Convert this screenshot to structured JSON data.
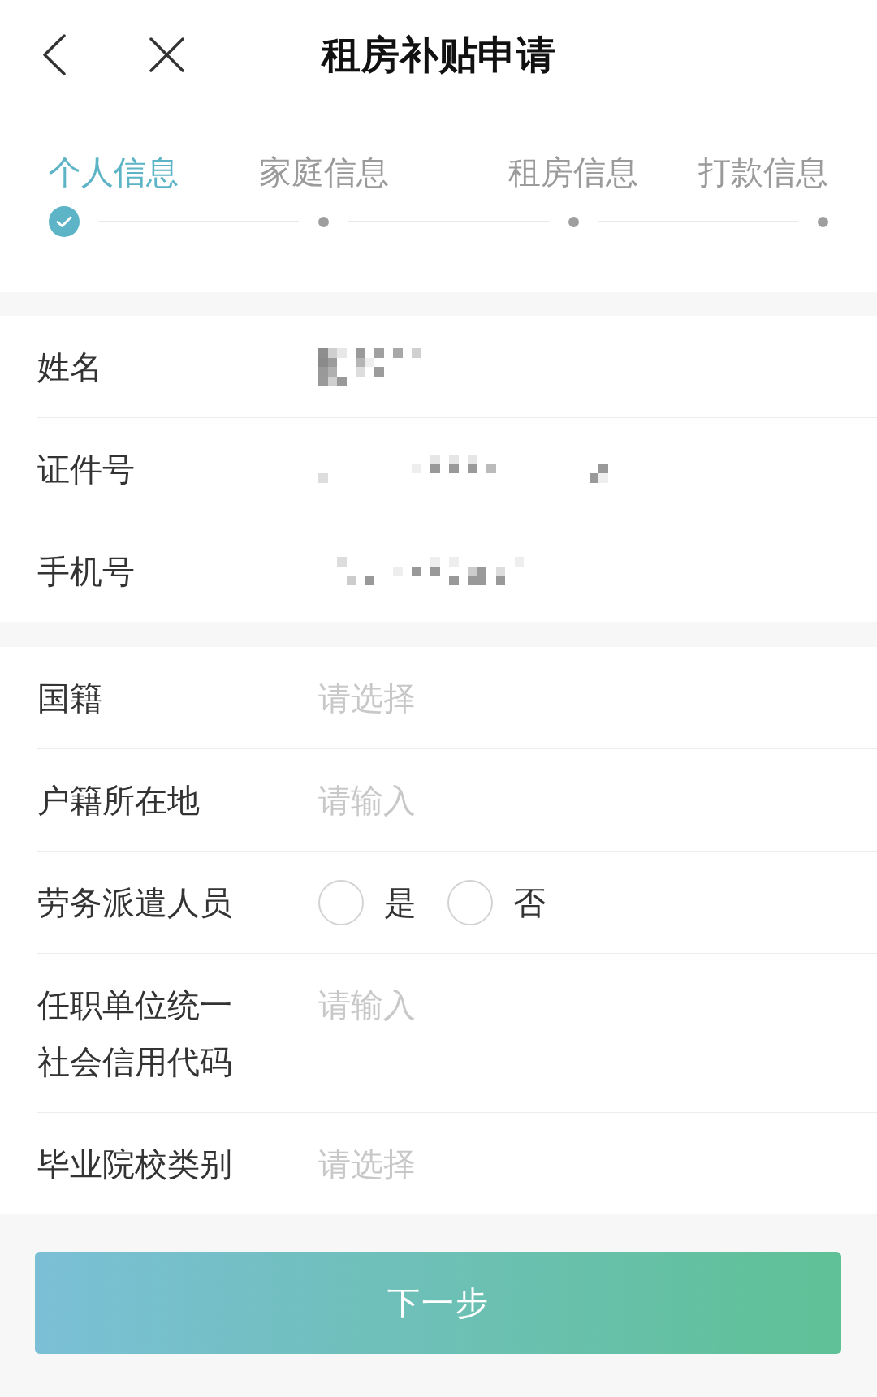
{
  "header": {
    "title": "租房补贴申请"
  },
  "steps": [
    {
      "label": "个人信息",
      "selected": true,
      "completed": true
    },
    {
      "label": "家庭信息",
      "selected": false,
      "completed": false
    },
    {
      "label": "租房信息",
      "selected": false,
      "completed": false
    },
    {
      "label": "打款信息",
      "selected": false,
      "completed": false
    }
  ],
  "sections": [
    {
      "rows": [
        {
          "kind": "masked",
          "label": "姓名"
        },
        {
          "kind": "masked",
          "label": "证件号"
        },
        {
          "kind": "masked",
          "label": "手机号"
        }
      ]
    },
    {
      "rows": [
        {
          "kind": "input",
          "label": "国籍",
          "placeholder": "请选择"
        },
        {
          "kind": "input",
          "label": "户籍所在地",
          "placeholder": "请输入"
        },
        {
          "kind": "radio",
          "label": "劳务派遣人员",
          "options": [
            {
              "label": "是",
              "selected": false
            },
            {
              "label": "否",
              "selected": false
            }
          ]
        },
        {
          "kind": "input",
          "label": "任职单位统一社会信用代码",
          "placeholder": "请输入"
        },
        {
          "kind": "input",
          "label": "毕业院校类别",
          "placeholder": "请选择"
        }
      ]
    }
  ],
  "next_button": {
    "label": "下一步"
  }
}
